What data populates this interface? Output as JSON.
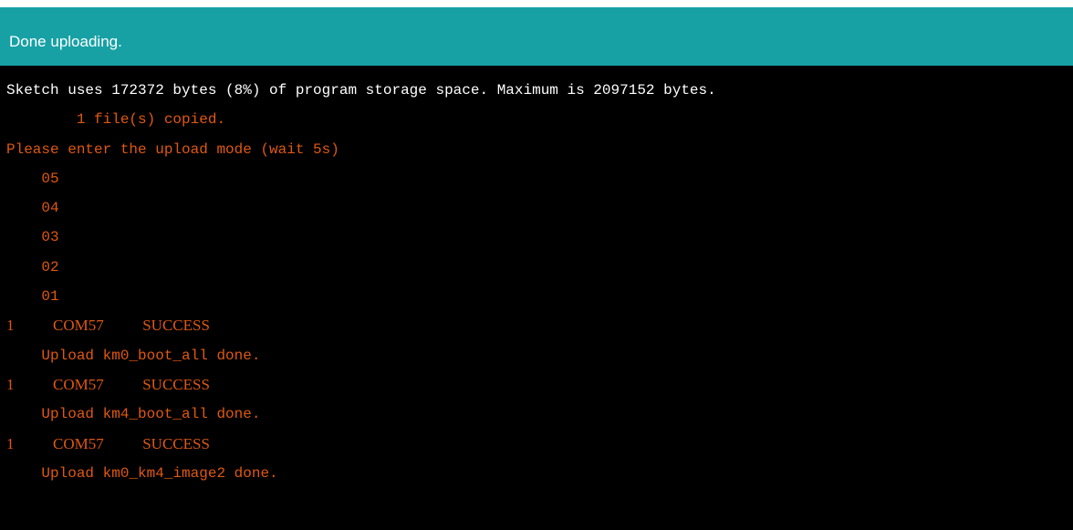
{
  "status": {
    "text": "Done uploading."
  },
  "colors": {
    "status_bar": "#17a1a5",
    "console_bg": "#000000",
    "stderr_text": "#e0580f",
    "stdout_text": "#ffffff"
  },
  "console": {
    "lines": [
      {
        "text": "Sketch uses 172372 bytes (8%) of program storage space. Maximum is 2097152 bytes.",
        "stream": "stdout"
      },
      {
        "text": "        1 file(s) copied.",
        "stream": "stderr"
      },
      {
        "text": "Please enter the upload mode (wait 5s)",
        "stream": "stderr"
      },
      {
        "text": "    05",
        "stream": "stderr"
      },
      {
        "text": "    04",
        "stream": "stderr"
      },
      {
        "text": "    03",
        "stream": "stderr"
      },
      {
        "text": "    02",
        "stream": "stderr"
      },
      {
        "text": "    01",
        "stream": "stderr"
      },
      {
        "text": "1          COM57          SUCCESS",
        "stream": "stderr",
        "font": "serif"
      },
      {
        "text": "    Upload km0_boot_all done.",
        "stream": "stderr"
      },
      {
        "text": "1          COM57          SUCCESS",
        "stream": "stderr",
        "font": "serif"
      },
      {
        "text": "    Upload km4_boot_all done.",
        "stream": "stderr"
      },
      {
        "text": "1          COM57          SUCCESS",
        "stream": "stderr",
        "font": "serif"
      },
      {
        "text": "    Upload km0_km4_image2 done.",
        "stream": "stderr"
      }
    ]
  }
}
